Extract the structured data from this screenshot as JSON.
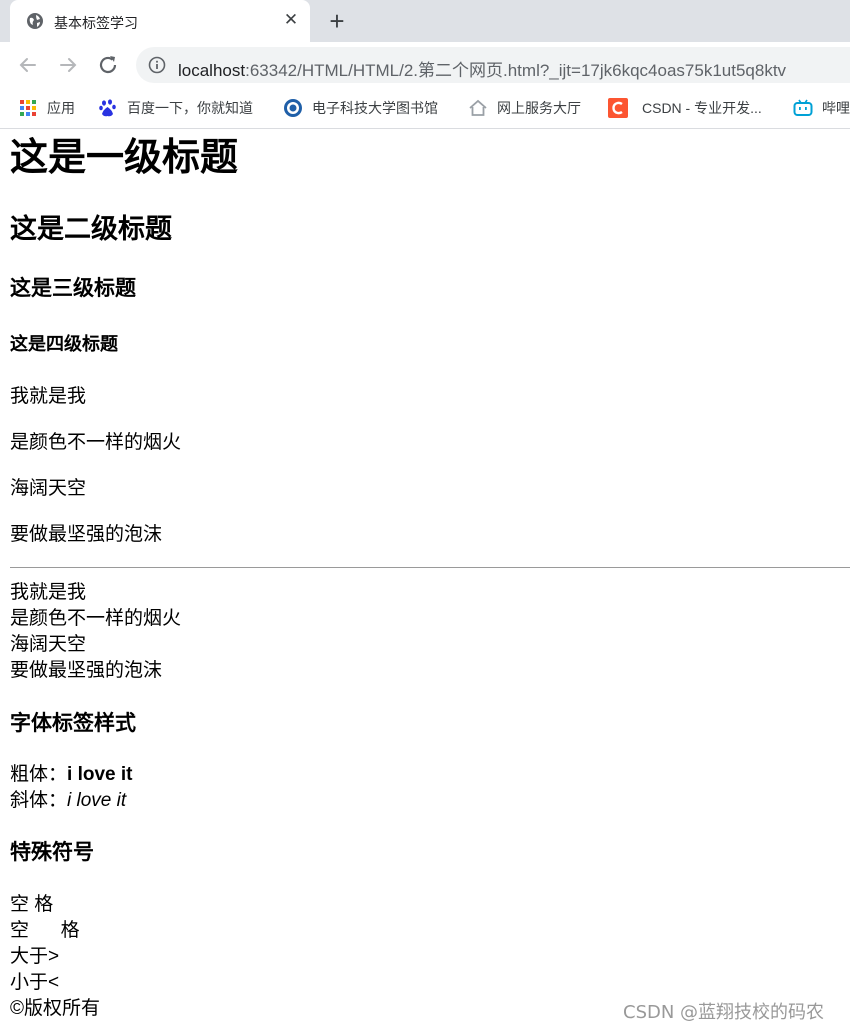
{
  "browser": {
    "tab_title": "基本标签学习",
    "tab_close_glyph": "✕",
    "new_tab_glyph": "+",
    "url_host": "localhost",
    "url_rest": ":63342/HTML/HTML/2.第二个网页.html?_ijt=17jk6kqc4oas75k1ut5q8ktv",
    "bookmarks": [
      "应用",
      "百度一下，你就知道",
      "电子科技大学图书馆",
      "网上服务大厅",
      "CSDN - 专业开发...",
      "哔哩"
    ]
  },
  "page": {
    "h1": "这是一级标题",
    "h2": "这是二级标题",
    "h3": "这是三级标题",
    "h4": "这是四级标题",
    "paragraphs": [
      "我就是我",
      "是颜色不一样的烟火",
      "海阔天空",
      "要做最坚强的泡沫"
    ],
    "lines": [
      "我就是我",
      "是颜色不一样的烟火",
      "海阔天空",
      "要做最坚强的泡沫"
    ],
    "font_section_title": "字体标签样式",
    "bold_label": "粗体：",
    "bold_text": "i love it",
    "italic_label": "斜体：",
    "italic_text": "i love it",
    "special_title": "特殊符号",
    "space_single": "空 格",
    "space_multi": "空      格",
    "greater_than": "大于>",
    "less_than": "小于<",
    "copyright": "©版权所有"
  },
  "watermark": "CSDN @蓝翔技校的码农",
  "colors": {
    "tabstrip": "#dee1e6",
    "omnibox": "#f1f3f4",
    "csdn_red": "#fc5531",
    "bilibili_blue": "#00a1d6",
    "baidu_blue": "#2932e1"
  }
}
